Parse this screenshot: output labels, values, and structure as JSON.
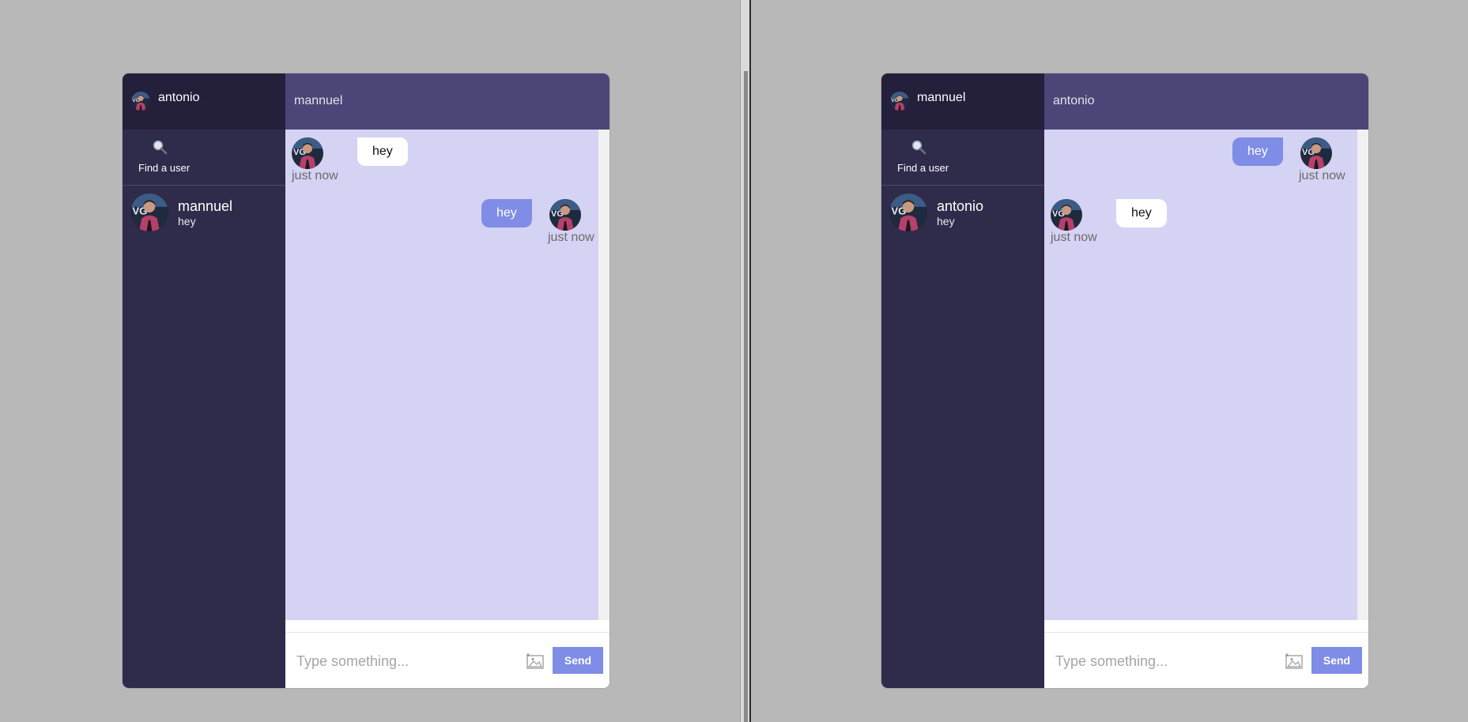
{
  "colors": {
    "sidebar_bg": "#2f2b4a",
    "sidebar_header_bg": "#241f3b",
    "chat_header_bg": "#4b4677",
    "messages_bg": "#d5d3f3",
    "accent": "#7f8de6"
  },
  "windows": [
    {
      "current_user": "antonio",
      "search_label": "Find a user",
      "chats": [
        {
          "name": "mannuel",
          "last_message": "hey"
        }
      ],
      "chat_title": "mannuel",
      "messages": [
        {
          "direction": "incoming",
          "text": "hey",
          "time": "just now"
        },
        {
          "direction": "outgoing",
          "text": "hey",
          "time": "just now"
        }
      ],
      "composer": {
        "placeholder": "Type something...",
        "send_label": "Send",
        "attach_icon": "image-icon"
      }
    },
    {
      "current_user": "mannuel",
      "search_label": "Find a user",
      "chats": [
        {
          "name": "antonio",
          "last_message": "hey"
        }
      ],
      "chat_title": "antonio",
      "messages": [
        {
          "direction": "outgoing",
          "text": "hey",
          "time": "just now"
        },
        {
          "direction": "incoming",
          "text": "hey",
          "time": "just now"
        }
      ],
      "composer": {
        "placeholder": "Type something...",
        "send_label": "Send",
        "attach_icon": "image-icon"
      }
    }
  ]
}
